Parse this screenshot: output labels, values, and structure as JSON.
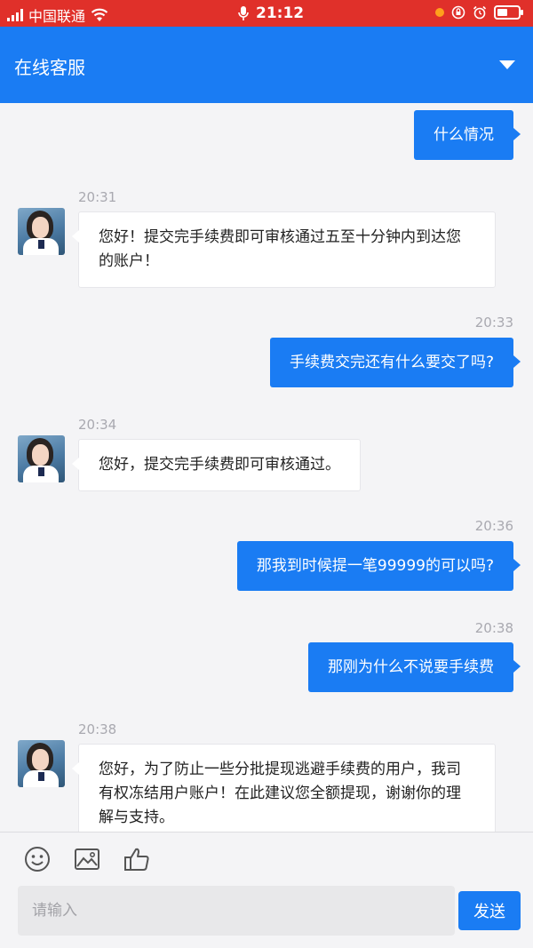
{
  "status_bar": {
    "carrier": "中国联通",
    "time": "21:12",
    "battery_level": 0.5
  },
  "header": {
    "title": "在线客服"
  },
  "messages": [
    {
      "direction": "out",
      "time": "",
      "text": "什么情况"
    },
    {
      "direction": "in",
      "time": "20:31",
      "text": "您好！提交完手续费即可审核通过五至十分钟内到达您的账户！"
    },
    {
      "direction": "out",
      "time": "20:33",
      "text": "手续费交完还有什么要交了吗?"
    },
    {
      "direction": "in",
      "time": "20:34",
      "text": "您好，提交完手续费即可审核通过。"
    },
    {
      "direction": "out",
      "time": "20:36",
      "text": "那我到时候提一笔99999的可以吗?"
    },
    {
      "direction": "out",
      "time": "20:38",
      "text": "那刚为什么不说要手续费"
    },
    {
      "direction": "in",
      "time": "20:38",
      "text": "您好，为了防止一些分批提现逃避手续费的用户，我司有权冻结用户账户！在此建议您全额提现，谢谢你的理解与支持。"
    }
  ],
  "composer": {
    "tools": [
      "smile-icon",
      "image-icon",
      "thumbs-up-icon"
    ],
    "placeholder": "请输入",
    "send_label": "发送"
  },
  "colors": {
    "status_bar": "#e0302a",
    "header": "#1a7cf3",
    "outgoing_bubble": "#1a7cf3",
    "incoming_bubble": "#ffffff"
  }
}
